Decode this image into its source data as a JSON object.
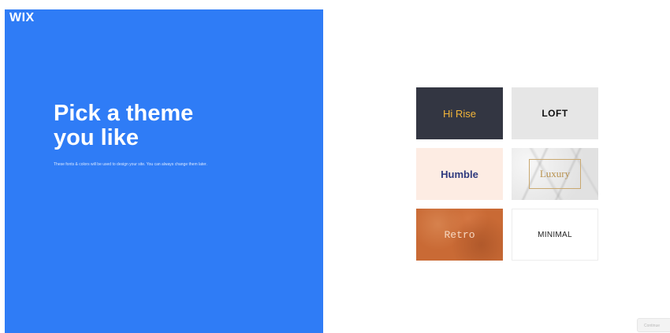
{
  "brand": {
    "logo_text": "WIX"
  },
  "intro": {
    "title": "Pick a theme\nyou like",
    "subtitle": "These fonts & colors will be used to design your site. You can always change them later."
  },
  "themes": [
    {
      "name": "Hi Rise",
      "background": "#333642",
      "text_color": "#f2b53a"
    },
    {
      "name": "LOFT",
      "background": "#e6e6e6",
      "text_color": "#111111"
    },
    {
      "name": "Humble",
      "background": "#fdece3",
      "text_color": "#2e3a7e"
    },
    {
      "name": "Luxury",
      "background": "#ececec",
      "text_color": "#b8924f"
    },
    {
      "name": "Retro",
      "background": "#c96a35",
      "text_color": "#f6d8c2"
    },
    {
      "name": "MINIMAL",
      "background": "#ffffff",
      "text_color": "#222222"
    }
  ],
  "footer": {
    "continue_label": "Continue"
  },
  "colors": {
    "accent": "#2f7cf6"
  }
}
